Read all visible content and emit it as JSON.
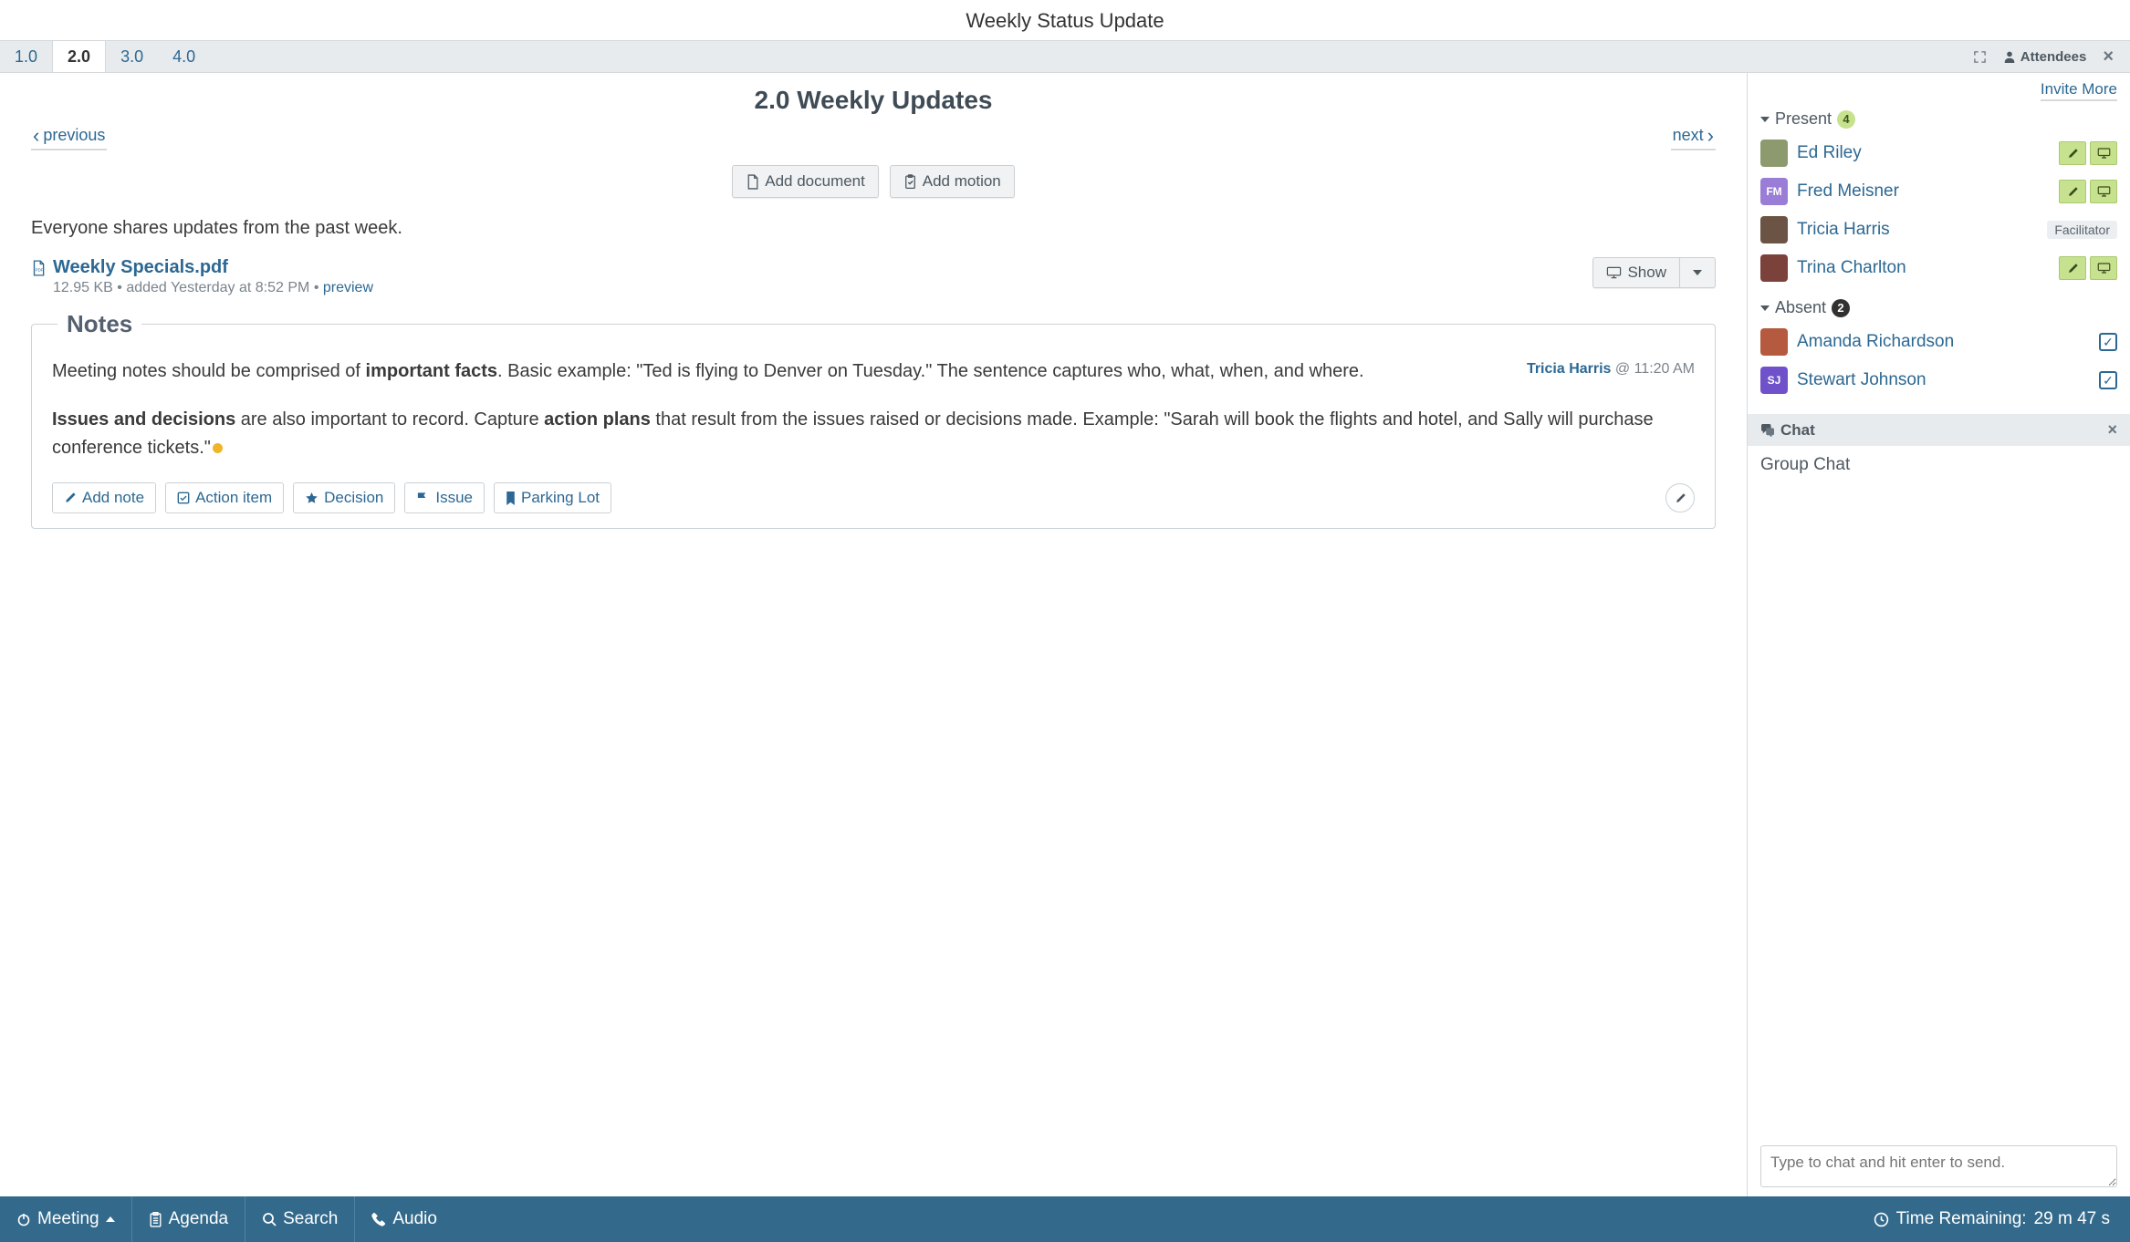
{
  "page": {
    "title": "Weekly Status Update"
  },
  "tabs": {
    "items": [
      "1.0",
      "2.0",
      "3.0",
      "4.0"
    ],
    "active_index": 1
  },
  "tabbar_right": {
    "fullscreen_icon": "fullscreen-icon",
    "attendees_icon": "person-icon",
    "attendees_label": "Attendees",
    "close_label": "×"
  },
  "section": {
    "heading": "2.0 Weekly Updates",
    "prev_label": "previous",
    "next_label": "next",
    "add_document_label": "Add document",
    "add_motion_label": "Add motion",
    "body": "Everyone shares updates from the past week."
  },
  "attachment": {
    "filename": "Weekly Specials.pdf",
    "size": "12.95 KB",
    "sep1": " • ",
    "added": "added Yesterday at 8:52 PM",
    "sep2": " • ",
    "preview_label": "preview",
    "show_label": "Show"
  },
  "notes": {
    "legend": "Notes",
    "author": "Tricia Harris",
    "at": " @ ",
    "time": "11:20 AM",
    "p1_a": "Meeting notes should be comprised of ",
    "p1_b": "important facts",
    "p1_c": ". Basic example: \"Ted is flying to Denver on Tuesday.\" The sentence captures who, what, when, and where.",
    "p2_a": "Issues and decisions",
    "p2_b": " are also important to record. Capture ",
    "p2_c": "action plans",
    "p2_d": " that result from the issues raised or decisions made. Example: \"Sarah will book the flights and hotel, and Sally will purchase conference tickets.\"",
    "footer": {
      "add_note": "Add note",
      "action_item": "Action item",
      "decision": "Decision",
      "issue": "Issue",
      "parking_lot": "Parking Lot"
    }
  },
  "attendees": {
    "invite_label": "Invite More",
    "present_label": "Present",
    "present_count": "4",
    "absent_label": "Absent",
    "absent_count": "2",
    "present": [
      {
        "name": "Ed Riley",
        "avatar_bg": "#8d9a6d",
        "initials": "",
        "role": "",
        "actions": "green"
      },
      {
        "name": "Fred Meisner",
        "avatar_bg": "#9a7dd6",
        "initials": "FM",
        "role": "",
        "actions": "green"
      },
      {
        "name": "Tricia Harris",
        "avatar_bg": "#6b5444",
        "initials": "",
        "role": "Facilitator",
        "actions": "none"
      },
      {
        "name": "Trina Charlton",
        "avatar_bg": "#7a423b",
        "initials": "",
        "role": "",
        "actions": "green"
      }
    ],
    "absent": [
      {
        "name": "Amanda Richardson",
        "avatar_bg": "#b55a3e",
        "initials": "",
        "checked": true
      },
      {
        "name": "Stewart Johnson",
        "avatar_bg": "#6f52c9",
        "initials": "SJ",
        "checked": true
      }
    ]
  },
  "chat": {
    "heading": "Chat",
    "group_label": "Group Chat",
    "placeholder": "Type to chat and hit enter to send."
  },
  "bottombar": {
    "meeting": "Meeting",
    "agenda": "Agenda",
    "search": "Search",
    "audio": "Audio",
    "time_remaining_label": "Time Remaining: ",
    "time_remaining_value": "29 m 47 s"
  }
}
